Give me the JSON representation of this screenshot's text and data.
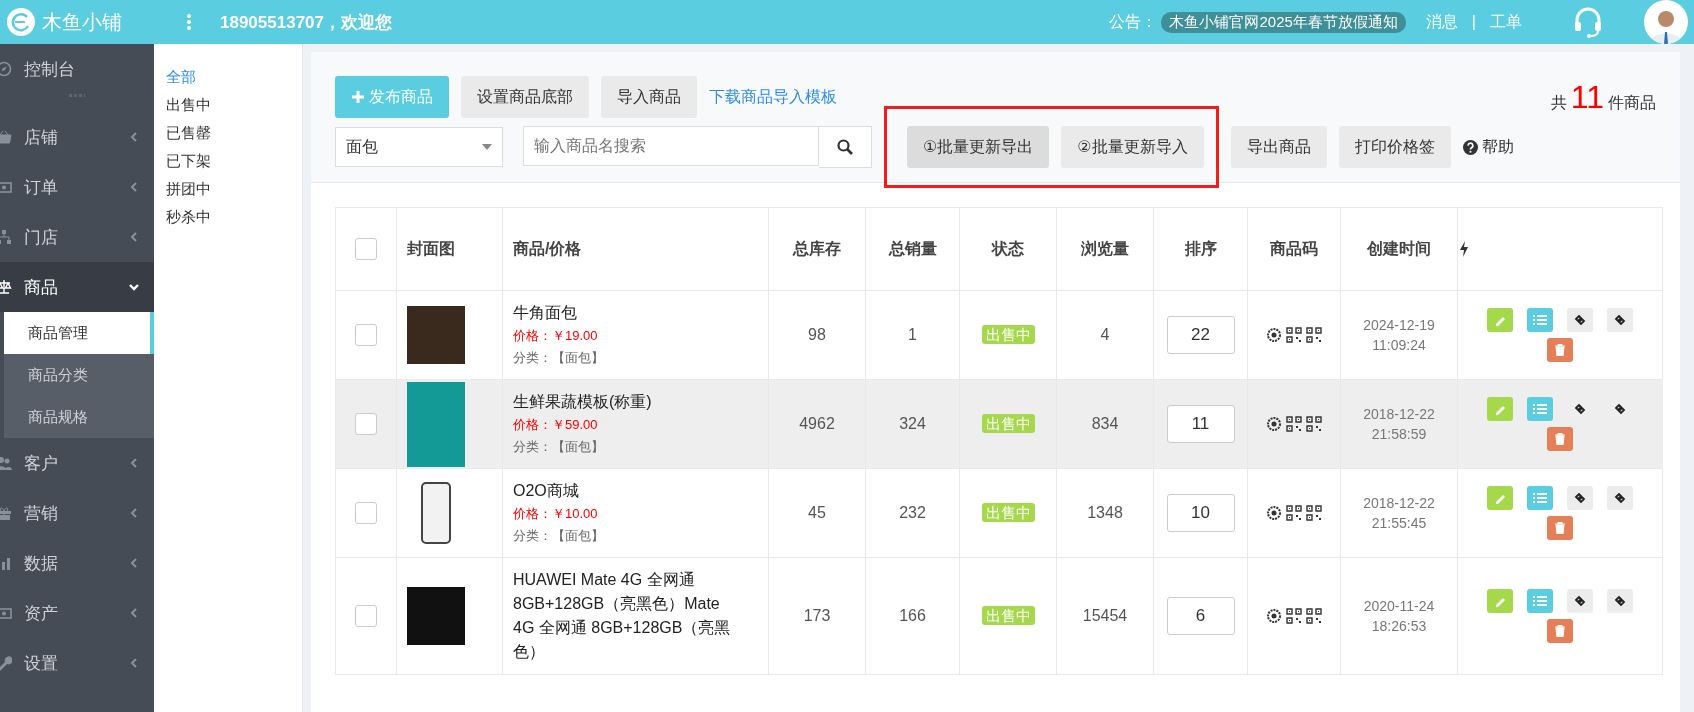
{
  "header": {
    "brand": "木鱼小铺",
    "greeting": "18905513707，欢迎您",
    "notice_label": "公告：",
    "notice": "木鱼小铺官网2025年春节放假通知",
    "links": [
      "消息",
      "工单"
    ],
    "separator": "|"
  },
  "sidebar": {
    "items": [
      {
        "label": "控制台",
        "kind": "link"
      },
      {
        "label": "店铺",
        "kind": "group",
        "expanded": false
      },
      {
        "label": "订单",
        "kind": "group",
        "expanded": false
      },
      {
        "label": "门店",
        "kind": "group",
        "expanded": false
      },
      {
        "label": "商品",
        "kind": "group",
        "expanded": true,
        "children": [
          {
            "label": "商品管理",
            "selected": true
          },
          {
            "label": "商品分类",
            "selected": false
          },
          {
            "label": "商品规格",
            "selected": false
          }
        ]
      },
      {
        "label": "客户",
        "kind": "group",
        "expanded": false
      },
      {
        "label": "营销",
        "kind": "group",
        "expanded": false
      },
      {
        "label": "数据",
        "kind": "group",
        "expanded": false
      },
      {
        "label": "资产",
        "kind": "group",
        "expanded": false
      },
      {
        "label": "设置",
        "kind": "group",
        "expanded": false
      }
    ]
  },
  "categories": {
    "items": [
      {
        "label": "全部",
        "selected": true
      },
      {
        "label": "出售中",
        "selected": false
      },
      {
        "label": "已售罄",
        "selected": false
      },
      {
        "label": "已下架",
        "selected": false
      },
      {
        "label": "拼团中",
        "selected": false
      },
      {
        "label": "秒杀中",
        "selected": false
      }
    ]
  },
  "toolbar": {
    "publish_button": "发布商品",
    "buttons": [
      "设置商品底部",
      "导入商品"
    ],
    "template_link": "下载商品导入模板",
    "total_prefix": "共",
    "total": "11",
    "total_suffix": "件商品",
    "category_select": "面包",
    "search": {
      "placeholder": "输入商品名搜索"
    },
    "highlighted_buttons": [
      "①批量更新导出",
      "②批量更新导入"
    ],
    "more_buttons": [
      "导出商品",
      "打印价格签"
    ],
    "help": "帮助"
  },
  "table": {
    "select_all": {
      "checked": false
    },
    "columns": [
      "封面图",
      "商品/价格",
      "总库存",
      "总销量",
      "状态",
      "浏览量",
      "排序",
      "商品码",
      "创建时间"
    ],
    "rows": [
      {
        "selected": false,
        "checked": false,
        "name": "牛角面包",
        "price_label": "价格：",
        "price": "￥19.00",
        "category": "分类：【面包】",
        "stock": "98",
        "sales": "1",
        "status": "出售中",
        "views": "4",
        "sort": "22",
        "created": [
          "2024-12-19",
          "11:09:24"
        ]
      },
      {
        "selected": true,
        "checked": false,
        "name": "生鲜果蔬模板(称重)",
        "price_label": "价格：",
        "price": "￥59.00",
        "category": "分类：【面包】",
        "stock": "4962",
        "sales": "324",
        "status": "出售中",
        "views": "834",
        "sort": "11",
        "created": [
          "2018-12-22",
          "21:58:59"
        ]
      },
      {
        "selected": false,
        "checked": false,
        "name": "O2O商城",
        "price_label": "价格：",
        "price": "￥10.00",
        "category": "分类：【面包】",
        "stock": "45",
        "sales": "232",
        "status": "出售中",
        "views": "1348",
        "sort": "10",
        "created": [
          "2018-12-22",
          "21:55:45"
        ]
      },
      {
        "selected": false,
        "checked": false,
        "name": "HUAWEI Mate 4G 全网通 8GB+128GB（亮黑色）Mate 4G 全网通 8GB+128GB（亮黑色）",
        "stock": "173",
        "sales": "166",
        "status": "出售中",
        "views": "15454",
        "sort": "6",
        "created": [
          "2020-11-24",
          "18:26:53"
        ]
      }
    ]
  }
}
